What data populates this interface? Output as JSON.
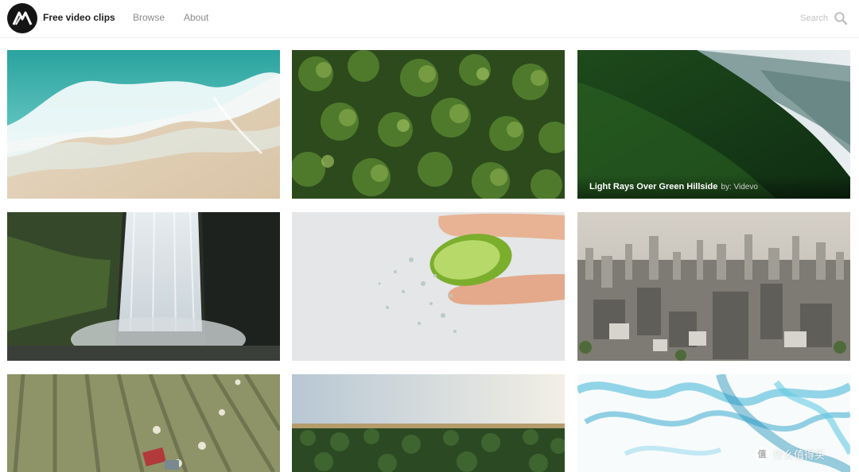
{
  "header": {
    "site_title": "Free video clips",
    "nav": {
      "browse": "Browse",
      "about": "About"
    },
    "search": {
      "placeholder": "Search",
      "value": "",
      "icon": "search-icon"
    },
    "logo_icon": "m-logo-icon"
  },
  "clips": [
    {
      "scene": "ocean-waves-beach",
      "caption": null
    },
    {
      "scene": "pine-forest-aerial",
      "caption": null
    },
    {
      "scene": "green-hillside",
      "caption": {
        "title": "Light Rays Over Green Hillside",
        "by": "by: Videvo"
      }
    },
    {
      "scene": "waterfall",
      "caption": null
    },
    {
      "scene": "lime-squeeze",
      "caption": null
    },
    {
      "scene": "city-aerial",
      "caption": null
    },
    {
      "scene": "hay-field-tractor",
      "caption": null
    },
    {
      "scene": "forest-sunrise",
      "caption": null
    },
    {
      "scene": "blue-smoke",
      "caption": null
    }
  ],
  "watermark": {
    "icon_glyph": "值",
    "text": "什么值得买"
  }
}
